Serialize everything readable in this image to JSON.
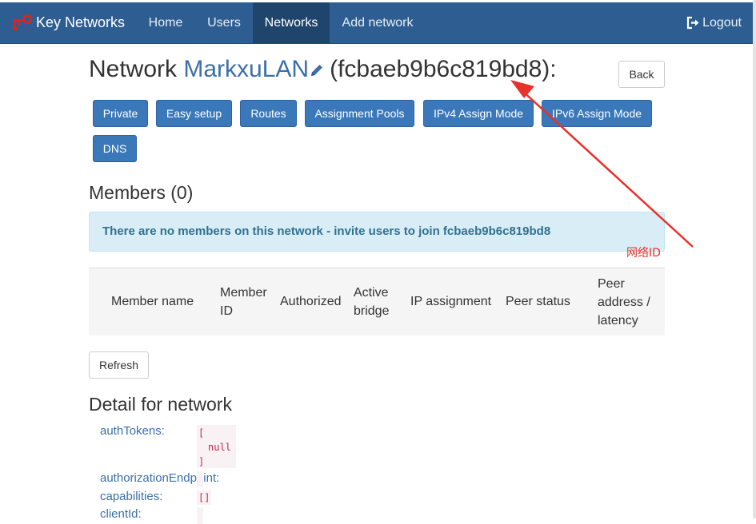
{
  "navbar": {
    "brand": "Key Networks",
    "items": [
      {
        "label": "Home"
      },
      {
        "label": "Users"
      },
      {
        "label": "Networks"
      },
      {
        "label": "Add network"
      }
    ],
    "logout": "Logout"
  },
  "title": {
    "prefix": "Network ",
    "name": "MarkxuLAN",
    "id_part": "(fcbaeb9b6c819bd8):"
  },
  "back_label": "Back",
  "buttons": [
    "Private",
    "Easy setup",
    "Routes",
    "Assignment Pools",
    "IPv4 Assign Mode",
    "IPv6 Assign Mode",
    "DNS"
  ],
  "members": {
    "title": "Members (0)",
    "empty_notice": "There are no members on this network - invite users to join fcbaeb9b6c819bd8",
    "columns": [
      "Member name",
      "Member ID",
      "Authorized",
      "Active bridge",
      "IP assignment",
      "Peer status",
      "Peer address / latency"
    ]
  },
  "annotation": "网络ID",
  "refresh_label": "Refresh",
  "detail": {
    "title": "Detail for network",
    "rows": [
      {
        "key": "authTokens:",
        "value_lines": [
          "[",
          "null",
          "]"
        ]
      },
      {
        "key": "authorizationEndpoint:",
        "value": ""
      },
      {
        "key": "capabilities:",
        "value": "[]"
      },
      {
        "key": "clientId:",
        "value": ""
      }
    ]
  },
  "colors": {
    "navbar": "#2e5e91",
    "navbar_active": "#1f456d",
    "primary_button": "#3a78b9",
    "link": "#3b6fa9",
    "alert_bg": "#d9edf7",
    "alert_text": "#31708f",
    "annotation": "#e8312a"
  }
}
